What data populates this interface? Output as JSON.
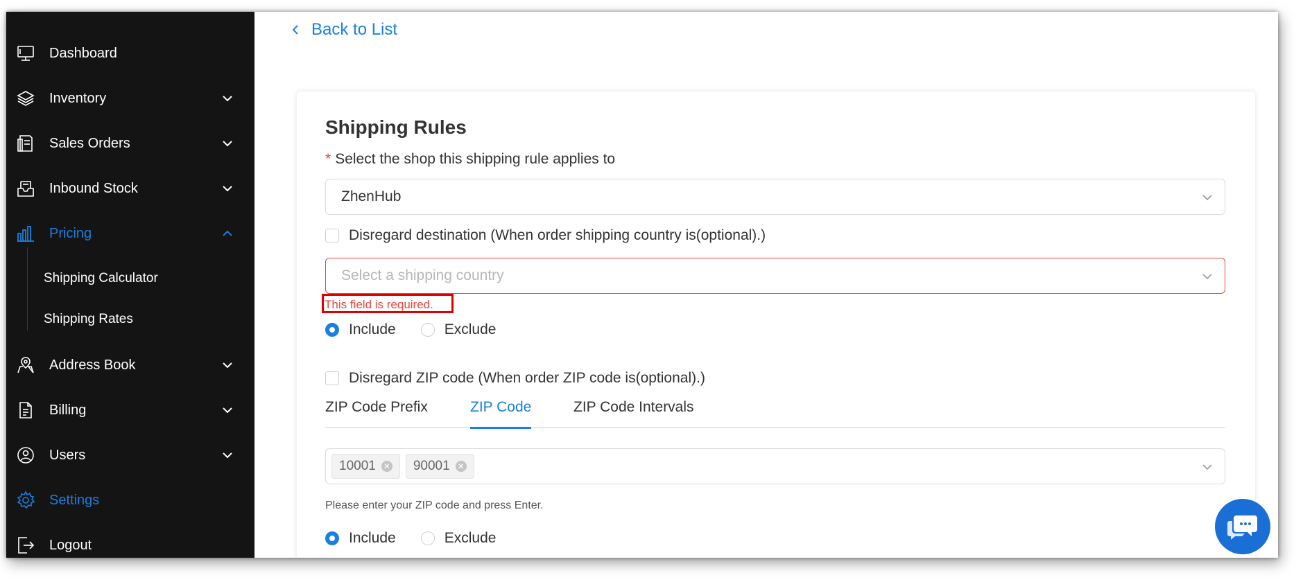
{
  "sidebar": {
    "items": [
      {
        "label": "Dashboard",
        "icon": "monitor-icon"
      },
      {
        "label": "Inventory",
        "icon": "layers-icon"
      },
      {
        "label": "Sales Orders",
        "icon": "orders-icon"
      },
      {
        "label": "Inbound Stock",
        "icon": "inbox-icon"
      },
      {
        "label": "Pricing",
        "icon": "bar-chart-icon"
      },
      {
        "label": "Address Book",
        "icon": "map-pin-icon"
      },
      {
        "label": "Billing",
        "icon": "document-icon"
      },
      {
        "label": "Users",
        "icon": "globe-user-icon"
      },
      {
        "label": "Settings",
        "icon": "gear-icon"
      },
      {
        "label": "Logout",
        "icon": "logout-icon"
      }
    ],
    "pricing_sub": [
      "Shipping Calculator",
      "Shipping Rates"
    ],
    "active_color": "#1a7fe0",
    "background": "#141414"
  },
  "main": {
    "back_label": "Back to List",
    "title": "Shipping Rules",
    "shop_label": "Select the shop this shipping rule applies to",
    "required_mark": "*",
    "shop_value": "ZhenHub",
    "dest_checkbox": "Disregard destination (When order shipping country is(optional).)",
    "country_placeholder": "Select a shipping country",
    "error_text": "This field is required.",
    "include_label": "Include",
    "exclude_label": "Exclude",
    "zip_checkbox": "Disregard ZIP code (When order ZIP code is(optional).)",
    "tabs": [
      "ZIP Code Prefix",
      "ZIP Code",
      "ZIP Code Intervals"
    ],
    "active_tab": "ZIP Code",
    "zip_tags": [
      "10001",
      "90001"
    ],
    "zip_hint": "Please enter your ZIP code and press Enter.",
    "include_label_2": "Include",
    "exclude_label_2": "Exclude"
  },
  "chat": {
    "icon": "chat-bubble-icon"
  },
  "colors": {
    "accent": "#1a7fe0",
    "error": "#e5483c",
    "highlight_box": "#e00000"
  }
}
